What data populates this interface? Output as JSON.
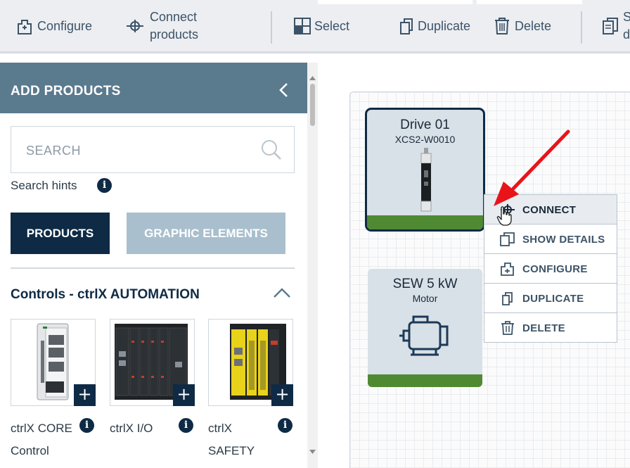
{
  "toolbar": {
    "configure": "Configure",
    "connect_line1": "Connect",
    "connect_line2": "products",
    "select": "Select",
    "duplicate": "Duplicate",
    "delete": "Delete",
    "cut_line1": "S",
    "cut_line2": "d"
  },
  "panel": {
    "title": "ADD PRODUCTS",
    "search_placeholder": "SEARCH",
    "search_hints": "Search hints",
    "tab_products": "PRODUCTS",
    "tab_graphic": "GRAPHIC ELEMENTS",
    "category_title": "Controls - ctrlX AUTOMATION",
    "products": [
      {
        "line1": "ctrlX CORE",
        "line2": "Control"
      },
      {
        "line1": "ctrlX I/O",
        "line2": ""
      },
      {
        "line1": "ctrlX",
        "line2": "SAFETY"
      }
    ],
    "add_symbol": "+",
    "info_symbol": "i"
  },
  "canvas": {
    "drive": {
      "title": "Drive 01",
      "subtitle": "XCS2-W0010"
    },
    "motor": {
      "title": "SEW 5 kW",
      "subtitle": "Motor"
    }
  },
  "context_menu": {
    "items": [
      {
        "label": "CONNECT",
        "icon": "connect-icon"
      },
      {
        "label": "SHOW DETAILS",
        "icon": "details-icon"
      },
      {
        "label": "CONFIGURE",
        "icon": "configure-icon"
      },
      {
        "label": "DUPLICATE",
        "icon": "duplicate-icon"
      },
      {
        "label": "DELETE",
        "icon": "trash-icon"
      }
    ]
  },
  "colors": {
    "accent_dark": "#0e2a45",
    "panel_header": "#5a7a8e",
    "status_green": "#4f8a33",
    "annotation_arrow": "#e8141a"
  }
}
